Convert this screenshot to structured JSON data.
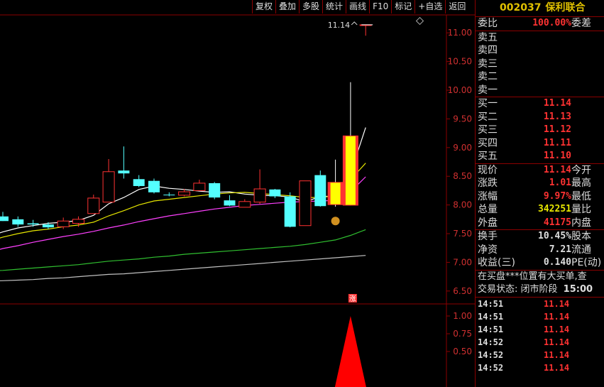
{
  "toolbar": [
    "复权",
    "叠加",
    "多股",
    "统计",
    "画线",
    "F10",
    "标记",
    "+自选",
    "返回"
  ],
  "stock": {
    "code": "002037",
    "name": "保利联合"
  },
  "chart_data": [
    {
      "type": "candlestick",
      "y_range": [
        6.3,
        11.3
      ],
      "y_ticks": [
        "11.00",
        "10.50",
        "10.00",
        "9.50",
        "9.00",
        "8.50",
        "8.00",
        "7.50",
        "7.00",
        "6.50"
      ],
      "price_label": "11.14",
      "candles": [
        {
          "o": 7.8,
          "h": 7.88,
          "l": 7.72,
          "c": 7.72
        },
        {
          "o": 7.75,
          "h": 7.8,
          "l": 7.62,
          "c": 7.66
        },
        {
          "o": 7.68,
          "h": 7.74,
          "l": 7.62,
          "c": 7.66
        },
        {
          "o": 7.66,
          "h": 7.7,
          "l": 7.58,
          "c": 7.61
        },
        {
          "o": 7.62,
          "h": 7.78,
          "l": 7.58,
          "c": 7.72
        },
        {
          "o": 7.68,
          "h": 7.8,
          "l": 7.62,
          "c": 7.75
        },
        {
          "o": 7.85,
          "h": 8.18,
          "l": 7.85,
          "c": 8.12
        },
        {
          "o": 8.05,
          "h": 8.8,
          "l": 8.05,
          "c": 8.58
        },
        {
          "o": 8.6,
          "h": 9.02,
          "l": 8.46,
          "c": 8.55
        },
        {
          "o": 8.45,
          "h": 8.52,
          "l": 8.31,
          "c": 8.33
        },
        {
          "o": 8.42,
          "h": 8.46,
          "l": 8.2,
          "c": 8.22
        },
        {
          "o": 8.18,
          "h": 8.22,
          "l": 8.15,
          "c": 8.17
        },
        {
          "o": 8.17,
          "h": 8.28,
          "l": 8.15,
          "c": 8.23
        },
        {
          "o": 8.25,
          "h": 8.44,
          "l": 8.25,
          "c": 8.38
        },
        {
          "o": 8.38,
          "h": 8.4,
          "l": 8.1,
          "c": 8.13
        },
        {
          "o": 8.08,
          "h": 8.17,
          "l": 7.98,
          "c": 7.99
        },
        {
          "o": 7.96,
          "h": 8.1,
          "l": 7.96,
          "c": 8.06
        },
        {
          "o": 8.05,
          "h": 8.62,
          "l": 8.02,
          "c": 8.28
        },
        {
          "o": 8.27,
          "h": 8.28,
          "l": 8.12,
          "c": 8.15
        },
        {
          "o": 8.15,
          "h": 8.22,
          "l": 7.61,
          "c": 7.62
        },
        {
          "o": 7.64,
          "h": 8.42,
          "l": 7.64,
          "c": 8.42
        },
        {
          "o": 8.52,
          "h": 8.6,
          "l": 7.97,
          "c": 7.98
        },
        {
          "o": 8.0,
          "h": 8.79,
          "l": 7.97,
          "c": 8.4
        },
        {
          "o": 7.99,
          "h": 10.14,
          "l": 7.99,
          "c": 9.21
        },
        {
          "o": 11.14,
          "h": 11.14,
          "l": 10.95,
          "c": 11.14
        }
      ],
      "moving_averages": [
        {
          "color": "#ffffff",
          "values": [
            7.45,
            7.53,
            7.6,
            7.64,
            7.68,
            7.7,
            7.73,
            7.82,
            8.02,
            8.13,
            8.27,
            8.33,
            8.29,
            8.27,
            8.24,
            8.22,
            8.23,
            8.19,
            8.17,
            8.16,
            8.14,
            8.05,
            8.15,
            8.15,
            8.55,
            9.35
          ]
        },
        {
          "color": "#e6e600",
          "values": [
            7.36,
            7.44,
            7.5,
            7.55,
            7.58,
            7.62,
            7.65,
            7.7,
            7.81,
            7.9,
            8.0,
            8.07,
            8.1,
            8.13,
            8.16,
            8.19,
            8.21,
            8.22,
            8.2,
            8.18,
            8.16,
            8.13,
            8.13,
            8.16,
            8.44,
            8.73
          ]
        },
        {
          "color": "#ff40ff",
          "values": [
            7.17,
            7.24,
            7.29,
            7.35,
            7.4,
            7.45,
            7.49,
            7.54,
            7.6,
            7.65,
            7.71,
            7.76,
            7.81,
            7.85,
            7.89,
            7.93,
            7.96,
            7.99,
            8.01,
            8.03,
            8.05,
            8.06,
            8.07,
            8.08,
            8.23,
            8.49
          ]
        },
        {
          "color": "#30c030",
          "values": [
            6.85,
            6.86,
            6.88,
            6.9,
            6.92,
            6.94,
            6.96,
            6.99,
            7.02,
            7.04,
            7.06,
            7.09,
            7.11,
            7.14,
            7.16,
            7.18,
            7.2,
            7.22,
            7.24,
            7.26,
            7.28,
            7.31,
            7.35,
            7.39,
            7.47,
            7.57
          ]
        },
        {
          "color": "#c0c0c0",
          "values": [
            6.67,
            6.68,
            6.69,
            6.7,
            6.72,
            6.73,
            6.75,
            6.77,
            6.79,
            6.8,
            6.82,
            6.84,
            6.86,
            6.88,
            6.9,
            6.92,
            6.94,
            6.96,
            6.98,
            7.0,
            7.02,
            7.04,
            7.06,
            7.08,
            7.1,
            7.12
          ]
        }
      ]
    },
    {
      "type": "area",
      "y_range": [
        0.0,
        1.15
      ],
      "y_ticks": [
        "1.00",
        "0.75",
        "0.50"
      ],
      "signal_value": 1.0
    }
  ],
  "markers": {
    "zhang": "涨"
  },
  "quote": {
    "weibi": {
      "label": "委比",
      "value": "100.00%",
      "label2": "委差"
    },
    "sell": [
      {
        "label": "卖五",
        "price": ""
      },
      {
        "label": "卖四",
        "price": ""
      },
      {
        "label": "卖三",
        "price": ""
      },
      {
        "label": "卖二",
        "price": ""
      },
      {
        "label": "卖一",
        "price": ""
      }
    ],
    "buy": [
      {
        "label": "买一",
        "price": "11.14"
      },
      {
        "label": "买二",
        "price": "11.13"
      },
      {
        "label": "买三",
        "price": "11.12"
      },
      {
        "label": "买四",
        "price": "11.11"
      },
      {
        "label": "买五",
        "price": "11.10"
      }
    ],
    "stats": [
      {
        "label": "现价",
        "value": "11.14",
        "label2": "今开"
      },
      {
        "label": "涨跌",
        "value": "1.01",
        "label2": "最高"
      },
      {
        "label": "涨幅",
        "value": "9.97%",
        "label2": "最低"
      },
      {
        "label": "总量",
        "value": "342251",
        "label2": "量比"
      },
      {
        "label": "外盘",
        "value": "41175",
        "label2": "内盘"
      }
    ],
    "fund": [
      {
        "label": "换手",
        "value": "10.45%",
        "label2": "股本"
      },
      {
        "label": "净资",
        "value": "7.21",
        "label2": "流通"
      },
      {
        "label": "收益(三)",
        "value": "0.140",
        "label2": "PE(动)"
      }
    ],
    "notice": "在买盘***位置有大买单,查",
    "trade_status": {
      "label": "交易状态: 闭市阶段",
      "time": "15:00"
    },
    "ticks": [
      {
        "time": "14:51",
        "price": "11.14"
      },
      {
        "time": "14:51",
        "price": "11.14"
      },
      {
        "time": "14:51",
        "price": "11.14"
      },
      {
        "time": "14:52",
        "price": "11.14"
      },
      {
        "time": "14:52",
        "price": "11.14"
      },
      {
        "time": "14:52",
        "price": "11.14"
      }
    ]
  }
}
